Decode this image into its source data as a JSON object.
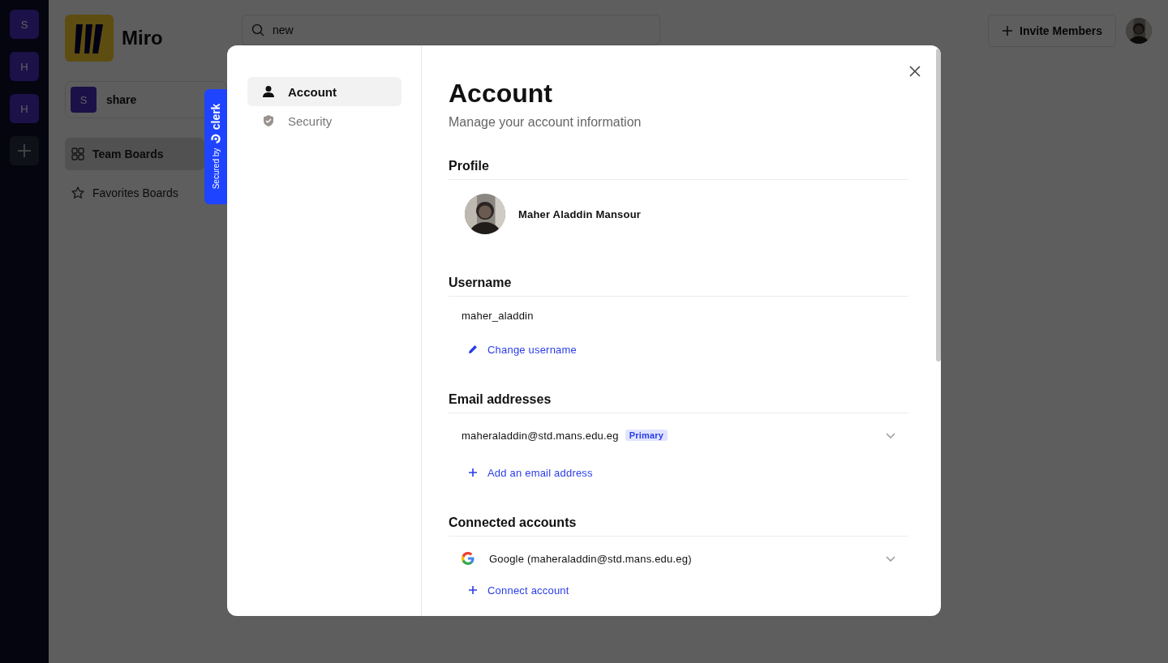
{
  "rail": {
    "workspaces": [
      {
        "letter": "S"
      },
      {
        "letter": "H"
      },
      {
        "letter": "H"
      }
    ]
  },
  "logo": {
    "name": "Miro"
  },
  "org_switcher": {
    "letter": "S",
    "name": "share"
  },
  "nav": [
    {
      "label": "Team Boards",
      "selected": true
    },
    {
      "label": "Favorites Boards",
      "selected": false
    }
  ],
  "search": {
    "value": "new"
  },
  "invite_button": {
    "label": "Invite Members"
  },
  "clerk_badge": {
    "text": "Secured by",
    "brand": "clerk"
  },
  "modal": {
    "nav": [
      {
        "label": "Account",
        "selected": true
      },
      {
        "label": "Security",
        "selected": false
      }
    ],
    "title": "Account",
    "subtitle": "Manage your account information",
    "sections": [
      {
        "kind": "profile",
        "title": "Profile",
        "name": "Maher Aladdin Mansour"
      },
      {
        "kind": "username",
        "title": "Username",
        "value": "maher_aladdin",
        "action": "Change username"
      },
      {
        "kind": "emails",
        "title": "Email addresses",
        "items": [
          {
            "text": "maheraladdin@std.mans.edu.eg",
            "badge": "Primary"
          }
        ],
        "action": "Add an email address"
      },
      {
        "kind": "connected",
        "title": "Connected accounts",
        "items": [
          {
            "text": "Google (maheraladdin@std.mans.edu.eg)"
          }
        ],
        "action": "Connect account"
      }
    ]
  }
}
